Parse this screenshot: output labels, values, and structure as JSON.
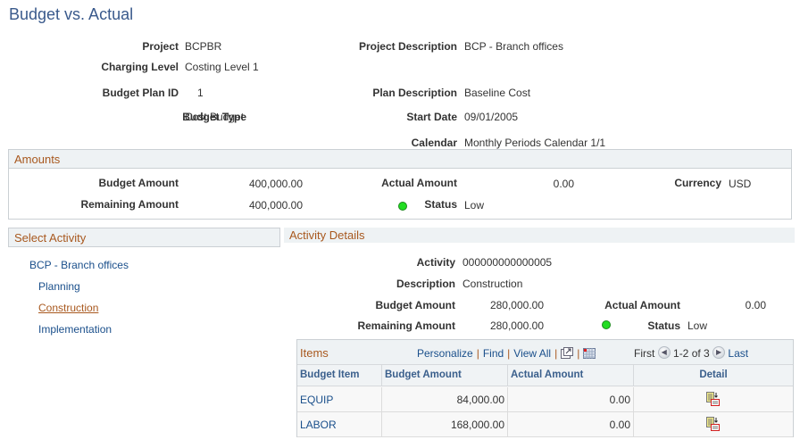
{
  "page": {
    "title": "Budget vs. Actual"
  },
  "header_fields": {
    "project": {
      "label": "Project",
      "value": "BCPBR"
    },
    "charging_level": {
      "label": "Charging Level",
      "value": "Costing Level 1"
    },
    "budget_plan_id": {
      "label": "Budget Plan ID",
      "value": "1"
    },
    "budget_type": {
      "label": "Budget Type",
      "value": "Cost Budget"
    },
    "project_description": {
      "label": "Project Description",
      "value": "BCP - Branch offices"
    },
    "plan_description": {
      "label": "Plan Description",
      "value": "Baseline Cost"
    },
    "start_date": {
      "label": "Start Date",
      "value": "09/01/2005"
    },
    "calendar": {
      "label": "Calendar",
      "value": "Monthly Periods Calendar 1/1"
    }
  },
  "amounts": {
    "title": "Amounts",
    "budget_amount": {
      "label": "Budget Amount",
      "value": "400,000.00"
    },
    "remaining_amount": {
      "label": "Remaining Amount",
      "value": "400,000.00"
    },
    "actual_amount": {
      "label": "Actual Amount",
      "value": "0.00"
    },
    "status": {
      "label": "Status",
      "value": "Low",
      "indicator_color": "#22dd22"
    },
    "currency": {
      "label": "Currency",
      "value": "USD"
    }
  },
  "select_activity": {
    "title": "Select Activity",
    "tree": [
      {
        "label": "BCP - Branch offices",
        "level": 0,
        "selected": false
      },
      {
        "label": "Planning",
        "level": 1,
        "selected": false
      },
      {
        "label": "Construction",
        "level": 1,
        "selected": true
      },
      {
        "label": "Implementation",
        "level": 1,
        "selected": false
      }
    ]
  },
  "activity_details": {
    "title": "Activity Details",
    "activity": {
      "label": "Activity",
      "value": "000000000000005"
    },
    "description": {
      "label": "Description",
      "value": "Construction"
    },
    "budget_amount": {
      "label": "Budget Amount",
      "value": "280,000.00"
    },
    "remaining_amount": {
      "label": "Remaining Amount",
      "value": "280,000.00"
    },
    "actual_amount": {
      "label": "Actual Amount",
      "value": "0.00"
    },
    "status": {
      "label": "Status",
      "value": "Low",
      "indicator_color": "#22dd22"
    }
  },
  "items_grid": {
    "title": "Items",
    "personalize": "Personalize",
    "find": "Find",
    "view_all": "View All",
    "first": "First",
    "range": "1-2 of 3",
    "last": "Last",
    "columns": [
      "Budget Item",
      "Budget Amount",
      "Actual Amount",
      "Detail"
    ],
    "rows": [
      {
        "budget_item": "EQUIP",
        "budget_amount": "84,000.00",
        "actual_amount": "0.00",
        "detail_icon": "detail-icon"
      },
      {
        "budget_item": "LABOR",
        "budget_amount": "168,000.00",
        "actual_amount": "0.00",
        "detail_icon": "detail-icon"
      }
    ]
  },
  "colors": {
    "title_blue": "#3a5a8c",
    "section_orange": "#a8581e",
    "link_blue": "#1a4f8b",
    "status_green": "#22dd22"
  }
}
